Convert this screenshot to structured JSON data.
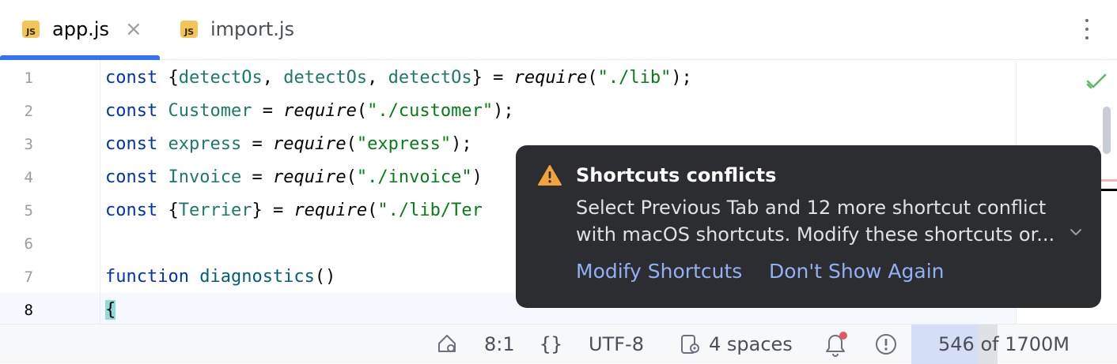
{
  "tabs": [
    {
      "icon": "JS",
      "label": "app.js",
      "close": "×",
      "active": true
    },
    {
      "icon": "JS",
      "label": "import.js",
      "active": false
    }
  ],
  "editor": {
    "line_numbers": [
      "1",
      "2",
      "3",
      "4",
      "5",
      "6",
      "7",
      "8"
    ],
    "lines": [
      {
        "t": [
          {
            "c": "kw",
            "s": "const"
          },
          {
            "c": "",
            "s": " {"
          },
          {
            "c": "var",
            "s": "detectOs"
          },
          {
            "c": "",
            "s": ", "
          },
          {
            "c": "var",
            "s": "detectOs"
          },
          {
            "c": "",
            "s": ", "
          },
          {
            "c": "var",
            "s": "detectOs"
          },
          {
            "c": "",
            "s": "} = "
          },
          {
            "c": "fn",
            "s": "require"
          },
          {
            "c": "",
            "s": "("
          },
          {
            "c": "str",
            "s": "\"./lib\""
          },
          {
            "c": "",
            "s": ");"
          }
        ]
      },
      {
        "t": [
          {
            "c": "kw",
            "s": "const"
          },
          {
            "c": "",
            "s": " "
          },
          {
            "c": "var",
            "s": "Customer"
          },
          {
            "c": "",
            "s": " = "
          },
          {
            "c": "fn",
            "s": "require"
          },
          {
            "c": "",
            "s": "("
          },
          {
            "c": "str",
            "s": "\"./customer\""
          },
          {
            "c": "",
            "s": ");"
          }
        ]
      },
      {
        "t": [
          {
            "c": "kw",
            "s": "const"
          },
          {
            "c": "",
            "s": " "
          },
          {
            "c": "var",
            "s": "express"
          },
          {
            "c": "",
            "s": " = "
          },
          {
            "c": "fn",
            "s": "require"
          },
          {
            "c": "",
            "s": "("
          },
          {
            "c": "str",
            "s": "\"express\""
          },
          {
            "c": "",
            "s": ");"
          }
        ]
      },
      {
        "t": [
          {
            "c": "kw",
            "s": "const"
          },
          {
            "c": "",
            "s": " "
          },
          {
            "c": "var",
            "s": "Invoice"
          },
          {
            "c": "",
            "s": " = "
          },
          {
            "c": "fn",
            "s": "require"
          },
          {
            "c": "",
            "s": "("
          },
          {
            "c": "str",
            "s": "\"./invoice\""
          },
          {
            "c": "",
            "s": ")"
          }
        ]
      },
      {
        "t": [
          {
            "c": "kw",
            "s": "const"
          },
          {
            "c": "",
            "s": " {"
          },
          {
            "c": "var",
            "s": "Terrier"
          },
          {
            "c": "",
            "s": "} = "
          },
          {
            "c": "fn",
            "s": "require"
          },
          {
            "c": "",
            "s": "("
          },
          {
            "c": "str",
            "s": "\"./lib/Ter"
          }
        ]
      },
      {
        "t": []
      },
      {
        "t": [
          {
            "c": "kw",
            "s": "function"
          },
          {
            "c": "",
            "s": " "
          },
          {
            "c": "fname",
            "s": "diagnostics"
          },
          {
            "c": "",
            "s": "()"
          }
        ]
      },
      {
        "t": [
          {
            "c": "brace-hl",
            "s": "{"
          }
        ]
      }
    ]
  },
  "notification": {
    "title": "Shortcuts conflicts",
    "body_line1": "Select Previous Tab and 12 more shortcut conflict",
    "body_line2": "with macOS shortcuts. Modify these shortcuts or...",
    "action1": "Modify Shortcuts",
    "action2": "Don't Show Again"
  },
  "status": {
    "position": "8:1",
    "encoding": "UTF-8",
    "indent": "4 spaces",
    "memory": "546 of 1700M",
    "memory_used_fraction": 0.3212,
    "memory_committed_fraction": 0.7
  },
  "colors": {
    "accent": "#3574f0",
    "notification_bg": "#2b2d30",
    "link": "#8fb1f5",
    "warning": "#f2a33a",
    "keyword": "#0033b3",
    "string": "#067d17"
  }
}
